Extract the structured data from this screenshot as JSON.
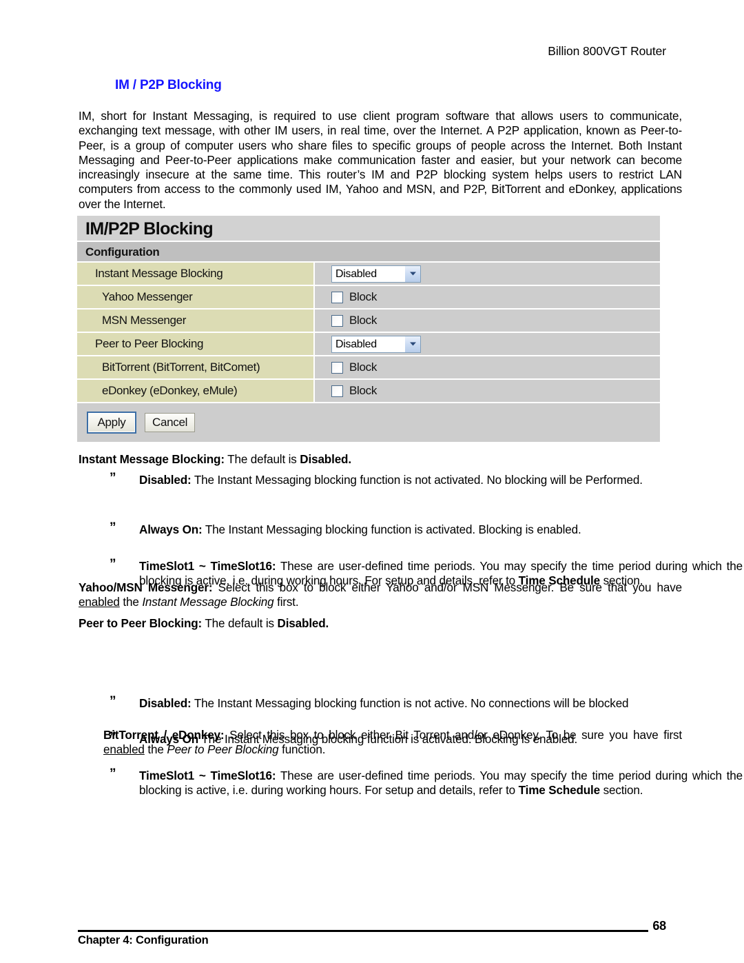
{
  "document": {
    "running_header": "Billion 800VGT Router",
    "section_heading": "IM / P2P Blocking",
    "intro_paragraph": "IM, short for Instant Messaging, is required to use client program software that allows users to communicate, exchanging text message, with other IM users, in real time, over the Internet. A P2P application, known as Peer-to-Peer, is a group of computer users who share files to specific groups of people across the Internet.   Both Instant Messaging and Peer-to-Peer applications make communication faster and easier, but your network can become increasingly insecure at the same time. This router’s IM and P2P blocking system helps users to restrict LAN computers from access to the commonly used IM, Yahoo and MSN, and P2P, BitTorrent and eDonkey, applications over the Internet."
  },
  "panel": {
    "title": "IM/P2P Blocking",
    "subtitle": "Configuration",
    "rows": [
      {
        "label": "Instant Message Blocking",
        "control": "select",
        "value": "Disabled",
        "indent": false
      },
      {
        "label": "Yahoo Messenger",
        "control": "checkbox",
        "value": "Block",
        "checked": false,
        "indent": true
      },
      {
        "label": "MSN Messenger",
        "control": "checkbox",
        "value": "Block",
        "checked": false,
        "indent": true
      },
      {
        "label": "Peer to Peer Blocking",
        "control": "select",
        "value": "Disabled",
        "indent": false
      },
      {
        "label": "BitTorrent (BitTorrent, BitComet)",
        "control": "checkbox",
        "value": "Block",
        "checked": false,
        "indent": true
      },
      {
        "label": "eDonkey (eDonkey, eMule)",
        "control": "checkbox",
        "value": "Block",
        "checked": false,
        "indent": true
      }
    ],
    "buttons": {
      "apply": "Apply",
      "cancel": "Cancel"
    },
    "colors": {
      "title_bar": "#d2d2d2",
      "subtitle_bar": "#bfbfbf",
      "label_cell": "#dcdcb4",
      "field_cell": "#cdcdcd",
      "select_border": "#7f9db9",
      "heading_blue": "#1414ff"
    }
  },
  "descriptions": {
    "bullet_mark": "”",
    "im_blocking": {
      "lead": "Instant Message Blocking:",
      "rest": " The default is ",
      "default_value": "Disabled."
    },
    "im_bullets": [
      {
        "term": "Disabled:",
        "text": " The Instant Messaging blocking function is not activated. No blocking will be Performed."
      },
      {
        "term": "Always On:",
        "text": " The Instant Messaging blocking function is activated. Blocking is enabled."
      },
      {
        "term": "TimeSlot1 ~ TimeSlot16:",
        "text_before": "  These are user-defined time periods. You may specify the time period during which the blocking is active, i.e. during working hours. For setup and details, refer to ",
        "ref": "Time Schedule",
        "text_after": " section."
      }
    ],
    "yahoo_msn": {
      "lead": "Yahoo/MSN Messenger:",
      "part1": " Select this box to block either Yahoo and/or MSN Messenger.   Be sure that you have ",
      "underlined": "enabled",
      "part2": " the ",
      "italic": "Instant Message Blocking",
      "part3": " first."
    },
    "p2p_blocking": {
      "lead": "Peer to Peer Blocking:",
      "rest": " The default is ",
      "default_value": "Disabled."
    },
    "p2p_bullets": [
      {
        "term": "Disabled:",
        "text": " The Instant Messaging blocking function is not active. No connections will be blocked"
      },
      {
        "term": "Always On",
        "text": " The Instant Messaging blocking function is activated. Blocking is enabled."
      },
      {
        "term": "TimeSlot1 ~ TimeSlot16:",
        "text_before": "  These are user-defined time periods. You may specify the time period during which the blocking is active, i.e. during working hours. For setup and details, refer to ",
        "ref": "Time Schedule",
        "text_after": " section."
      }
    ],
    "bittorrent_edonkey": {
      "lead": "BitTorrent / eDonkey:",
      "part1": " Select this box to block either Bit Torrent and/or eDonkey.   To be sure you have first ",
      "underlined": "enabled",
      "part2": " the ",
      "italic": "Peer to Peer Blocking",
      "part3": " function."
    }
  },
  "footer": {
    "page_number": "68",
    "chapter": "Chapter 4: Configuration"
  }
}
